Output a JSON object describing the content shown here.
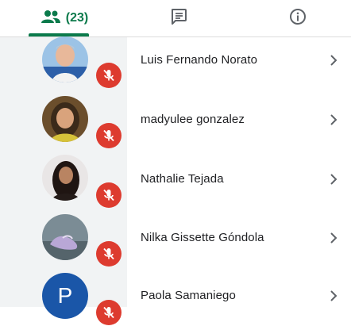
{
  "tabs": {
    "people_count": "(23)"
  },
  "participants": [
    {
      "name": "Luis Fernando Norato",
      "avatar_letter": "",
      "muted": true
    },
    {
      "name": "madyulee gonzalez",
      "avatar_letter": "",
      "muted": true
    },
    {
      "name": "Nathalie Tejada",
      "avatar_letter": "",
      "muted": true
    },
    {
      "name": "Nilka Gissette Góndola",
      "avatar_letter": "",
      "muted": true
    },
    {
      "name": "Paola Samaniego",
      "avatar_letter": "P",
      "muted": true
    }
  ],
  "icons": {
    "people_tab": "people-icon",
    "chat_tab": "chat-icon",
    "info_tab": "info-icon",
    "muted": "mic-off-icon",
    "open_details": "chevron-right-icon"
  },
  "colors": {
    "accent": "#0b7a4b",
    "mute_badge": "#dd3b2f",
    "avatar_blue": "#1a56a8"
  }
}
